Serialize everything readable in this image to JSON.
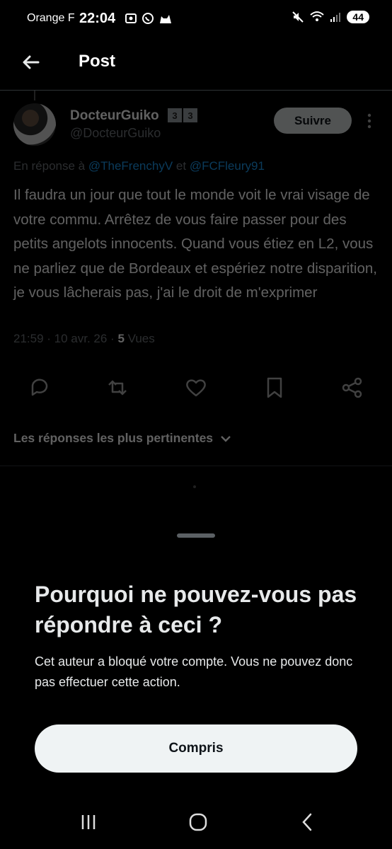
{
  "status_bar": {
    "carrier": "Orange F",
    "time": "22:04",
    "battery": "44"
  },
  "header": {
    "title": "Post"
  },
  "tweet": {
    "display_name": "DocteurGuiko",
    "badges": [
      "3",
      "3"
    ],
    "handle": "@DocteurGuiko",
    "follow_label": "Suivre",
    "reply_prefix": "En réponse à",
    "reply_mention_1": "@TheFrenchyV",
    "reply_joiner": "et",
    "reply_mention_2": "@FCFleury91",
    "text": "Il faudra un jour que tout le monde voit le vrai visage de votre commu. Arrêtez de vous faire passer pour des petits angelots innocents. Quand vous étiez en L2, vous ne parliez que de Bordeaux et espériez notre disparition, je vous lâcherais pas, j'ai le droit de m'exprimer",
    "timestamp": "21:59 · 10 avr. 26 ·",
    "views_count": "5",
    "views_label": "Vues"
  },
  "replies_sort": {
    "label": "Les réponses les plus pertinentes"
  },
  "sheet": {
    "title": "Pourquoi ne pouvez-vous pas répondre à ceci ?",
    "body": "Cet auteur a bloqué votre compte. Vous ne pouvez donc pas effectuer cette action.",
    "button_label": "Compris"
  },
  "colors": {
    "accent": "#1d9bf0",
    "muted": "#71767b",
    "background": "#000000"
  }
}
